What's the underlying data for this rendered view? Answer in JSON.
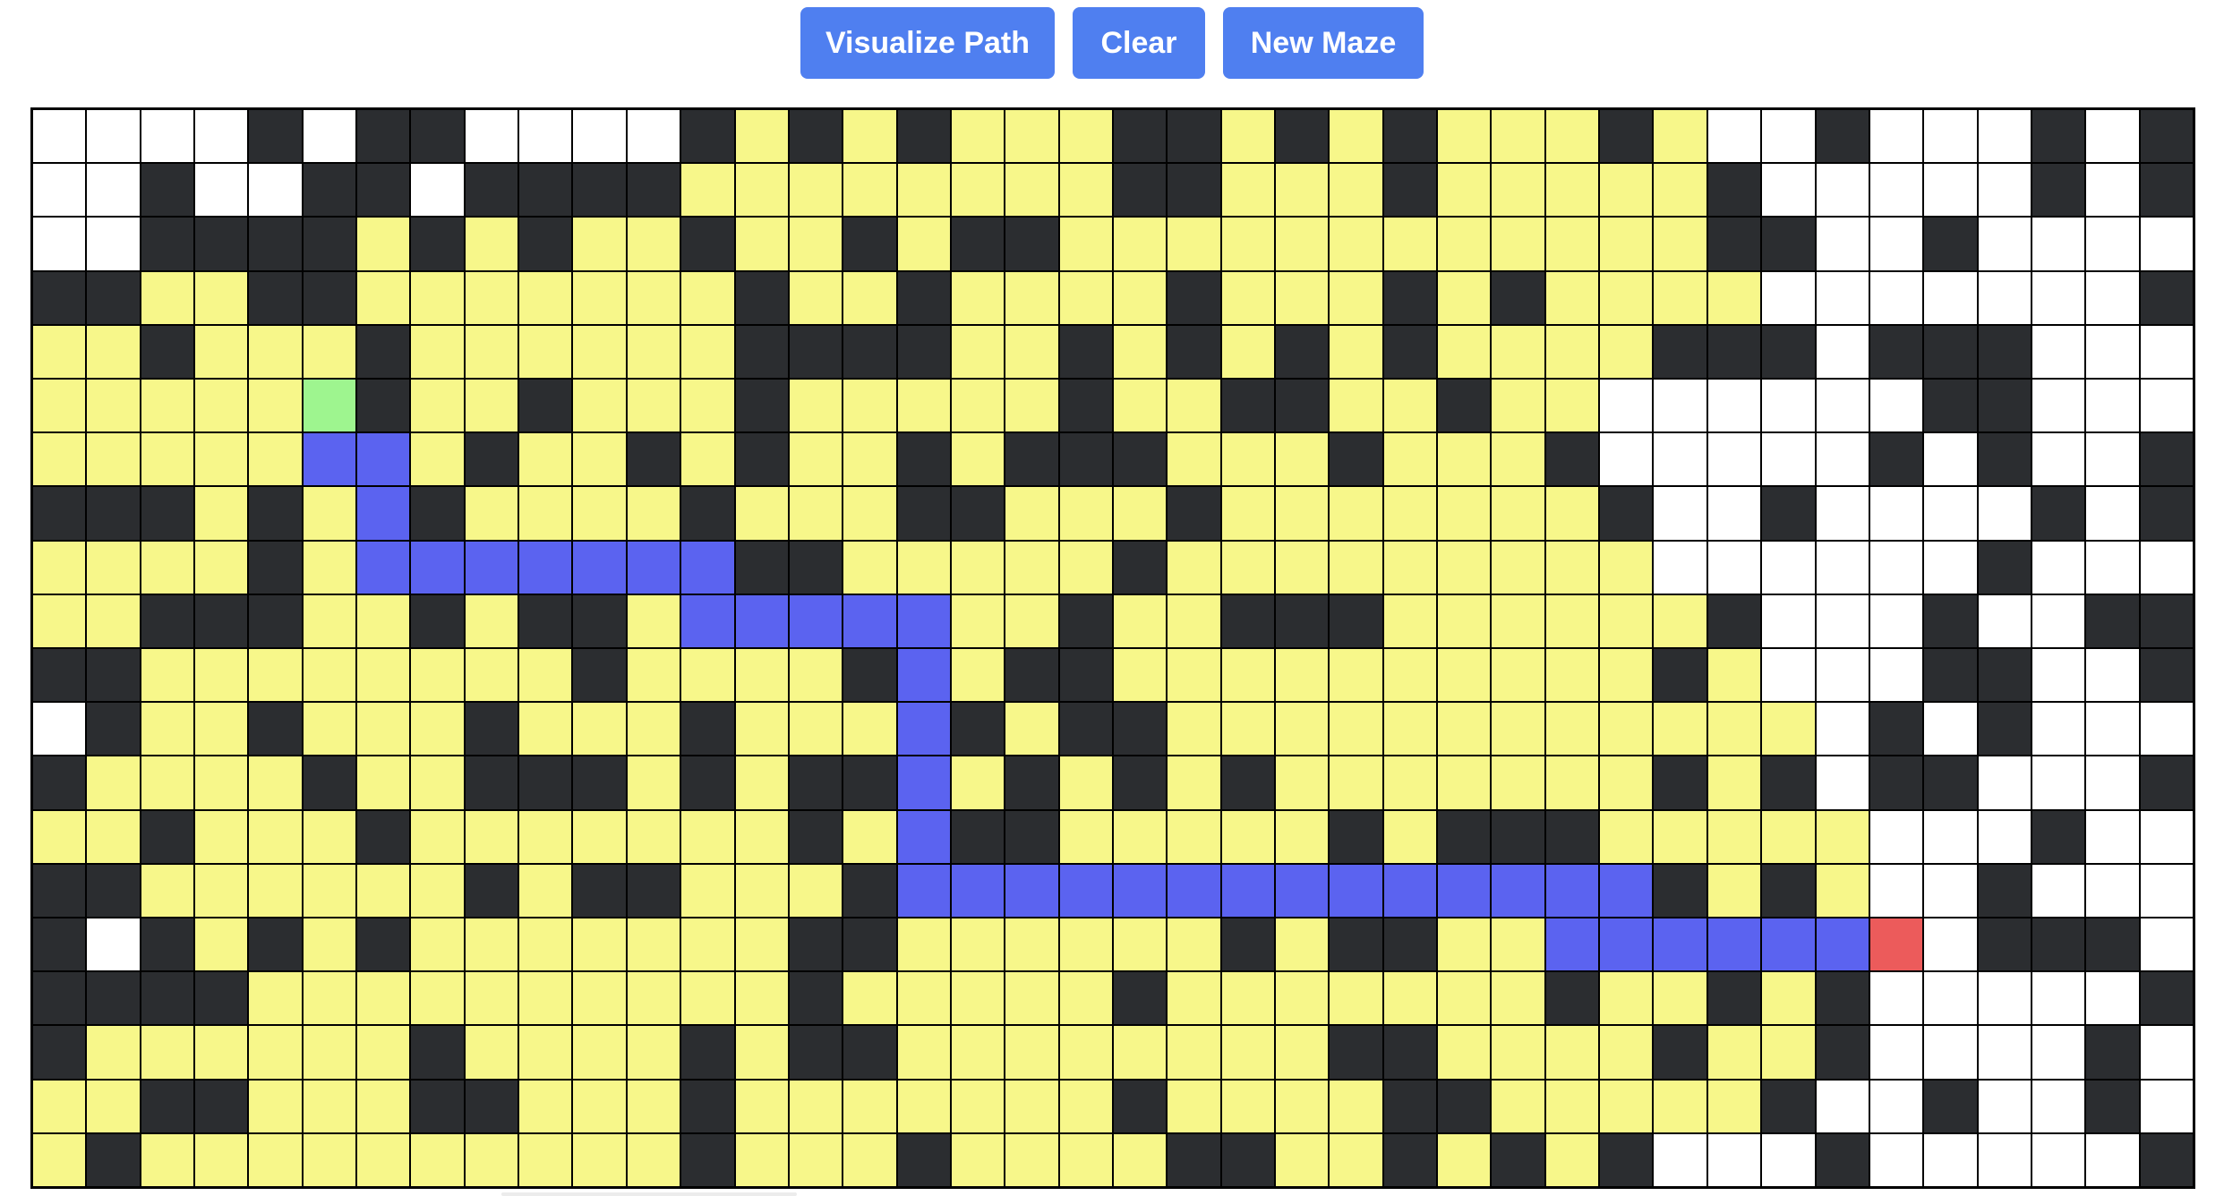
{
  "toolbar": {
    "visualize_label": "Visualize Path",
    "clear_label": "Clear",
    "new_maze_label": "New Maze",
    "button_color": "#4f7ff0"
  },
  "maze": {
    "rows": 20,
    "cols": 40,
    "legend": {
      "W": {
        "meaning": "unvisited",
        "color": "#ffffff"
      },
      "X": {
        "meaning": "wall",
        "color": "#2b2d30"
      },
      "Y": {
        "meaning": "visited",
        "color": "#f7f78a"
      },
      "P": {
        "meaning": "path",
        "color": "#5b63f0"
      },
      "S": {
        "meaning": "start",
        "color": "#9ef58f"
      },
      "E": {
        "meaning": "end",
        "color": "#ec5b5b"
      }
    },
    "grid": [
      "WWWWXWXXWWWWXYXYXYYYXXYXYXYYYXYWWXWWWXWX",
      "WWXWWXXWXXXXYYYYYYYYXXYYYXYYYYYXWWWWWXWX",
      "WWXXXXYXYXYYXYYXYXXYYYYYYYYYYYYXXWWXWWWW",
      "XXYYXXYYYYYYYXYYXYYYYXYYYXYXYYYYWWWWWWWX",
      "YYXYYYXYYYYYYXXXXYYXYXYXYXYYYYXXXWXXXWWW",
      "YYYYYSXYYXYYYXYYYYYXYYXXYYXYYWWWWWWXXWWW",
      "YYYYYPPYXYYXYXYYXYXXXYYYXYYYXWWWWWXWXWWX",
      "XXXYXYPXYYYYXYYYXXYYYXYYYYYYYXWWXWWWWXWX",
      "YYYYXYPPPPPPPXXYYYYYXYYYYYYYYYWWWWWWXWWW",
      "YYXXXYYXYXXYPPPPPYYXYYXXXYYYYYYXWWWXWWXX",
      "XXYYYYYYYYXYYYYXPYXXYYYYYYYYYYXYWWWXXWWX",
      "WXYYXYYYXYYYXYYYPXYXXYYYYYYYYYYYYWXWXWWW",
      "XYYYYXYYXXXYXYXXPYXYXYXYYYYYYYXYXWXXWWWX",
      "YYXYYYXYYYYYYYXYPXXYYYYYXYXXXYYYYYWWWXWW",
      "XXYYYYYYXYXXYYYXPPPPPPPPPPPPPPXYXYWWXWWW",
      "XWXYXYXYYYYYYYXXYYYYYYXYXXYYPPPPPPEWXXXW",
      "XXXXYYYYYYYYYYXYYYYYXYYYYYYYXYYXYXWWWWWX",
      "XYYYYYYXYYYYXYXXYYYYYYYYXXYYYYXYYXWWWWXW",
      "YYXXYYYXXYYYXYYYYYYYXYYYYXXYYYYYXWWXWWXW",
      "YXYYYYYYYYYYXYYYXYYYYXXYYXYXYXWWWXWWWWWX"
    ]
  }
}
